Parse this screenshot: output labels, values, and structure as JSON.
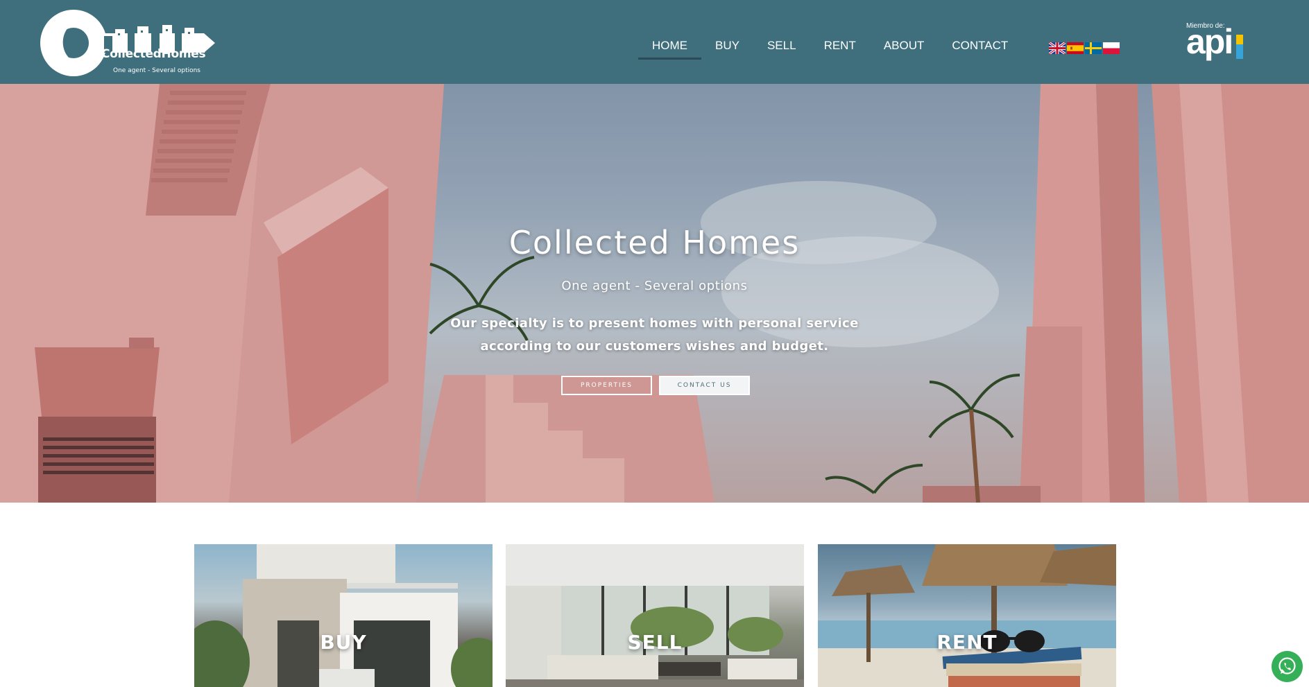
{
  "brand": {
    "name": "CollectedHomes",
    "tagline": "One agent - Several options"
  },
  "nav": {
    "items": [
      {
        "label": "HOME",
        "active": true
      },
      {
        "label": "BUY",
        "active": false
      },
      {
        "label": "SELL",
        "active": false
      },
      {
        "label": "RENT",
        "active": false
      },
      {
        "label": "ABOUT",
        "active": false
      },
      {
        "label": "CONTACT",
        "active": false
      }
    ]
  },
  "languages": [
    "english-flag-icon",
    "spanish-flag-icon",
    "swedish-flag-icon",
    "polish-flag-icon"
  ],
  "member": {
    "prefix": "Miembro de:",
    "name": "api"
  },
  "hero": {
    "title": "Collected Homes",
    "subtitle": "One agent - Several options",
    "description_line1": "Our specialty is to present homes with personal service",
    "description_line2": "according to our customers wishes and budget.",
    "button_properties": "PROPERTIES",
    "button_contact": "CONTACT US"
  },
  "cards": [
    {
      "label": "BUY"
    },
    {
      "label": "SELL"
    },
    {
      "label": "RENT"
    }
  ],
  "colors": {
    "header_bg": "#3f6e7d",
    "active_underline": "#2b4a55",
    "whatsapp_green": "#35b058"
  },
  "icons": {
    "whatsapp": "whatsapp-icon",
    "logo": "key-city-logo"
  }
}
